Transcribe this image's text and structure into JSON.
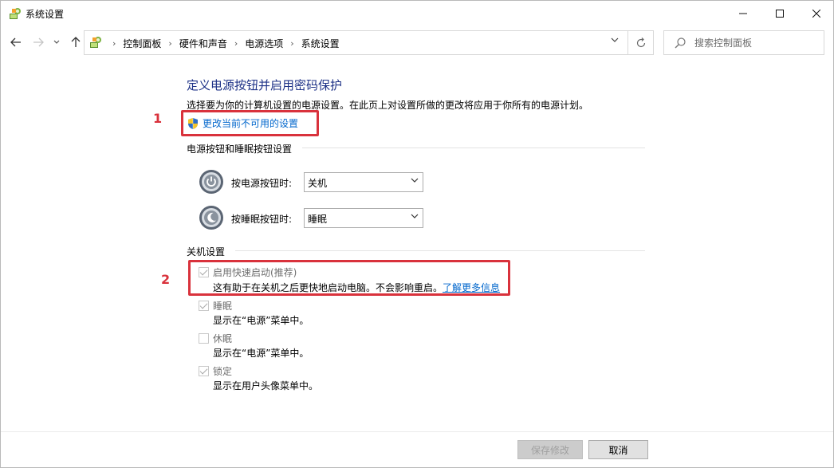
{
  "window": {
    "title": "系统设置",
    "icon": "control-panel-icon",
    "minimize_icon": "minimize-icon",
    "maximize_icon": "maximize-icon",
    "close_icon": "close-icon"
  },
  "nav": {
    "breadcrumbs": [
      "控制面板",
      "硬件和声音",
      "电源选项",
      "系统设置"
    ],
    "search_placeholder": "搜索控制面板"
  },
  "content": {
    "heading": "定义电源按钮并启用密码保护",
    "description": "选择要为你的计算机设置的电源设置。在此页上对设置所做的更改将应用于你所有的电源计划。",
    "change_link": "更改当前不可用的设置",
    "power_section_title": "电源按钮和睡眠按钮设置",
    "power_button_label": "按电源按钮时:",
    "power_button_value": "关机",
    "sleep_button_label": "按睡眠按钮时:",
    "sleep_button_value": "睡眠",
    "shutdown_section_title": "关机设置",
    "shutdown_options": [
      {
        "label": "启用快速启动(推荐)",
        "checked": true,
        "desc": "这有助于在关机之后更快地启动电脑。不会影响重启。",
        "link": "了解更多信息"
      },
      {
        "label": "睡眠",
        "checked": true,
        "desc": "显示在“电源”菜单中。"
      },
      {
        "label": "休眠",
        "checked": false,
        "desc": "显示在“电源”菜单中。"
      },
      {
        "label": "锁定",
        "checked": true,
        "desc": "显示在用户头像菜单中。"
      }
    ]
  },
  "annotations": {
    "marker_1": "1",
    "marker_2": "2",
    "color": "#d9323c"
  },
  "footer": {
    "save_label": "保存修改",
    "cancel_label": "取消"
  },
  "colors": {
    "heading": "#1e3287",
    "link": "#0066cc",
    "disabled_text": "#6d6d6d"
  }
}
